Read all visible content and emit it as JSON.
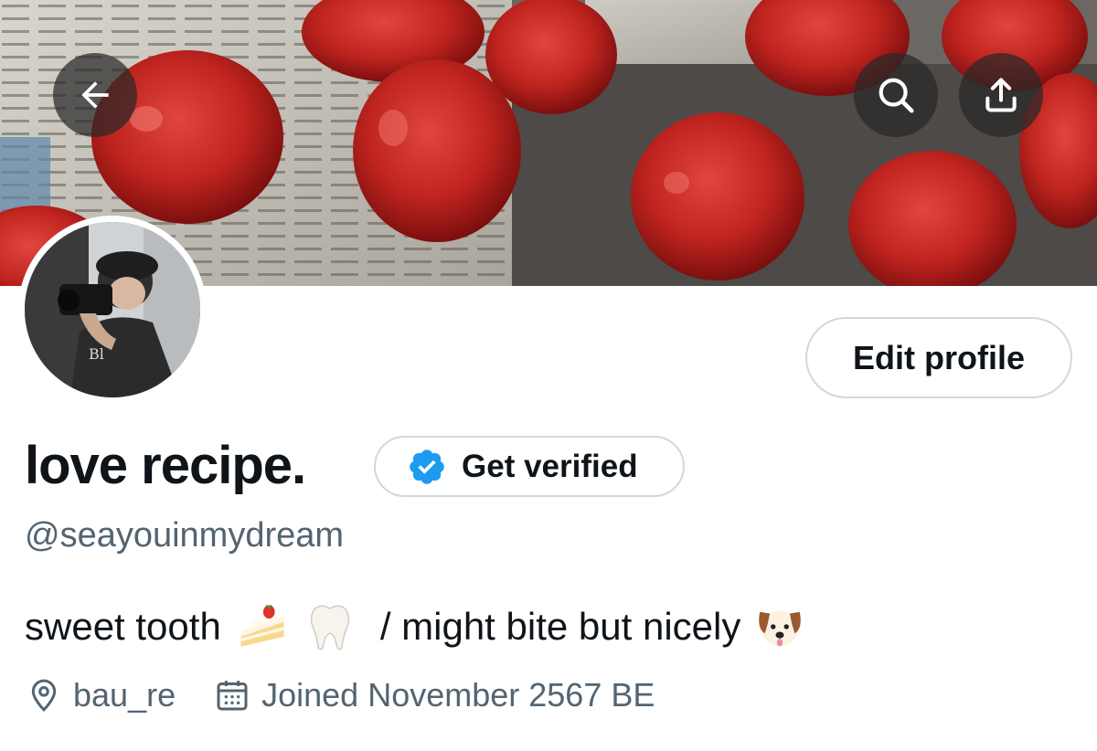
{
  "header": {
    "back_icon": "arrow-left-icon",
    "search_icon": "search-icon",
    "share_icon": "share-upload-icon"
  },
  "profile": {
    "display_name": "love recipe.",
    "handle": "@seayouinmydream",
    "edit_label": "Edit profile",
    "verify_label": "Get verified",
    "verify_badge_color": "#1d9bf0",
    "bio_part1": "sweet tooth",
    "bio_part2": "/ might bite but nicely",
    "bio_emojis": [
      "shortcake-emoji",
      "tooth-emoji",
      "dog-face-emoji"
    ],
    "location": "bau_re",
    "location_icon": "location-pin-icon",
    "joined": "Joined November 2567 BE",
    "joined_icon": "calendar-icon"
  },
  "colors": {
    "text_primary": "#0f1419",
    "text_secondary": "#536471",
    "border": "#cfd9de",
    "accent": "#1d9bf0"
  }
}
